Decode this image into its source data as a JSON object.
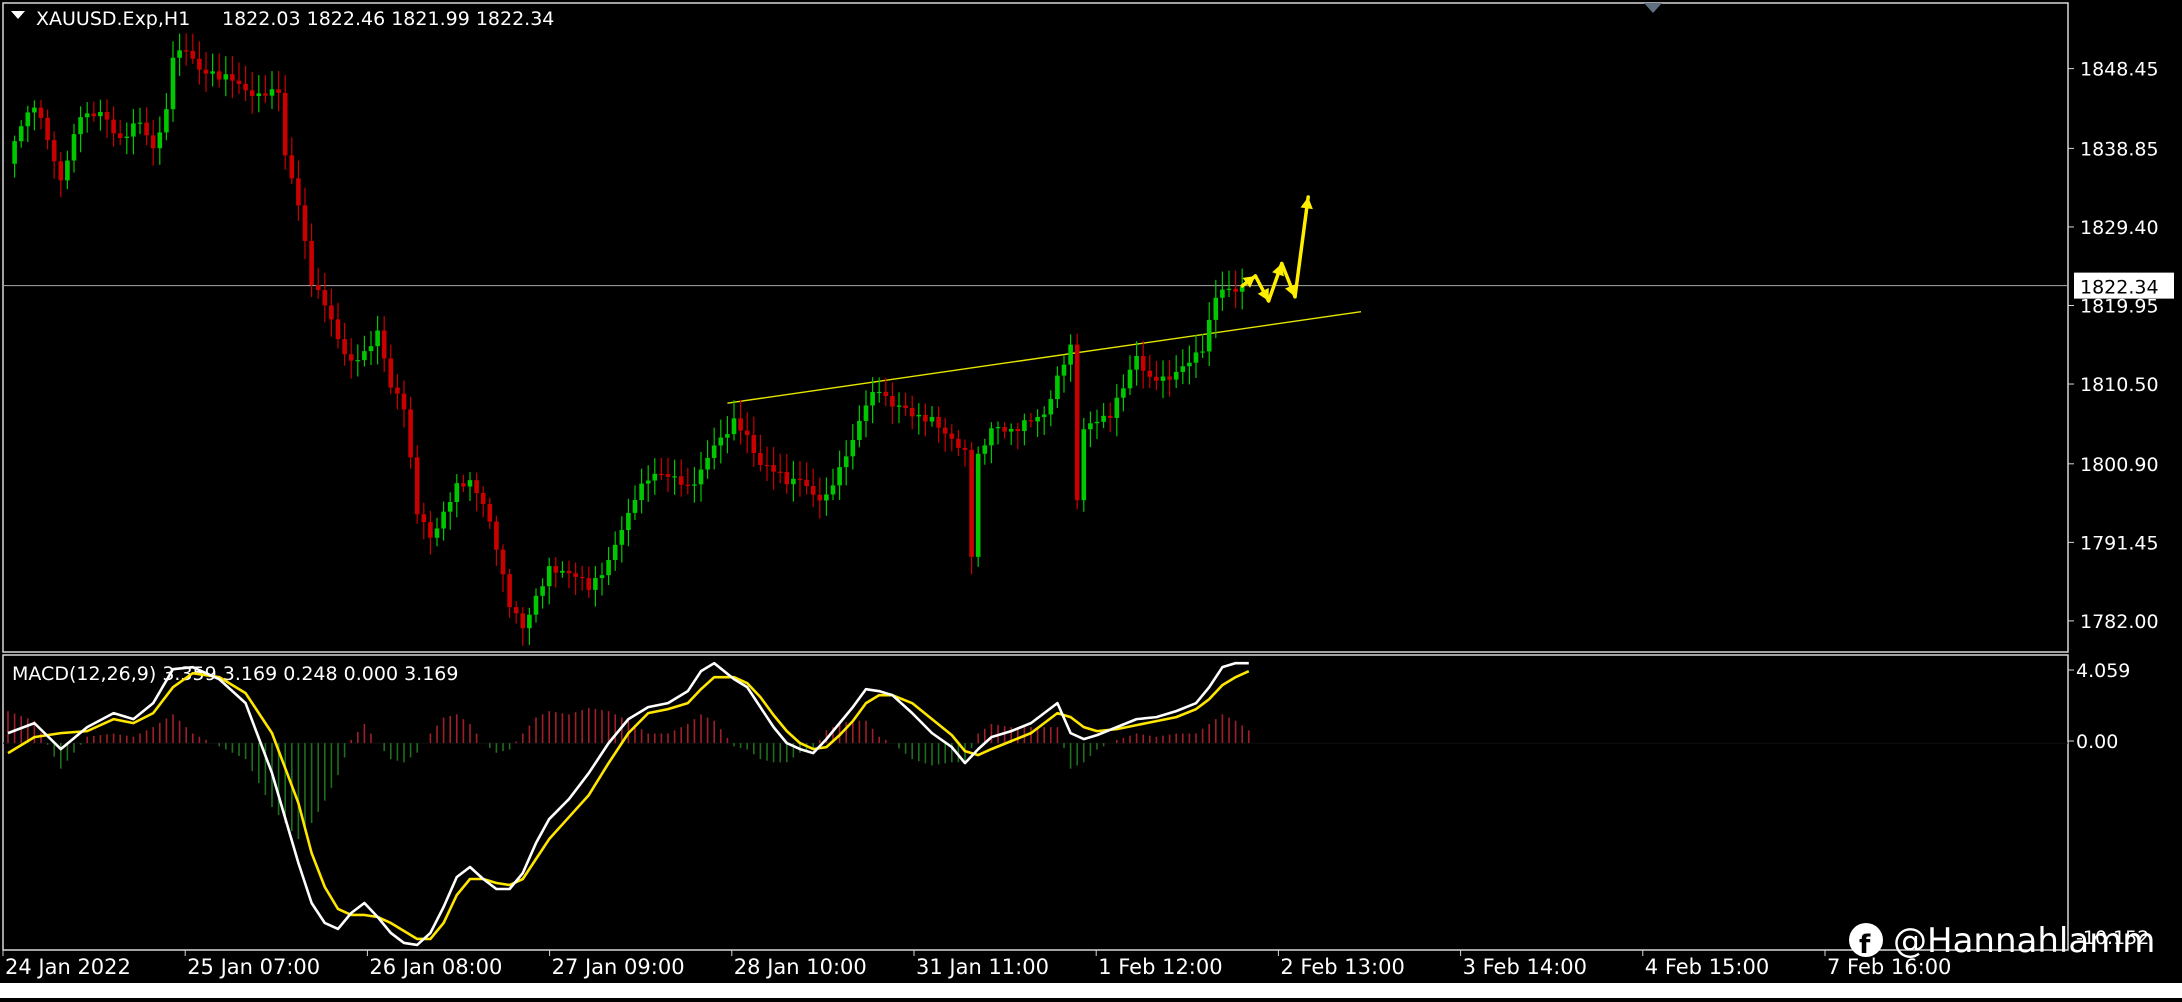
{
  "header": {
    "symbol_label": "XAUUSD.Exp,H1",
    "ohlc_label": "1822.03 1822.46 1821.99 1822.34",
    "dropdown_icon": "triangle-down-icon"
  },
  "macd_header": {
    "label": "MACD(12,26,9) 3.359 3.169 0.248 0.000 3.169"
  },
  "price_axis": {
    "ticks": [
      "1848.45",
      "1838.85",
      "1829.40",
      "1819.95",
      "1810.50",
      "1800.90",
      "1791.45",
      "1782.00"
    ],
    "current_price_label": "1822.34"
  },
  "macd_axis": {
    "ticks": [
      "4.059",
      "0.00"
    ],
    "bottom_tick": "-10.152"
  },
  "time_axis": {
    "labels": [
      "24 Jan 2022",
      "25 Jan 07:00",
      "26 Jan 08:00",
      "27 Jan 09:00",
      "28 Jan 10:00",
      "31 Jan 11:00",
      "1 Feb 12:00",
      "2 Feb 13:00",
      "3 Feb 14:00",
      "4 Feb 15:00",
      "7 Feb 16:00"
    ]
  },
  "watermark": {
    "text": "@Hannahlamm",
    "icon": "facebook-icon"
  },
  "colors": {
    "background": "#000000",
    "bull": "#00c800",
    "bear": "#c80000",
    "macd_line": "#ffffff",
    "signal_line": "#ffe600",
    "trendline": "#e6e600",
    "arrows": "#ffee00",
    "hist_pos": "#a01e2a",
    "hist_neg": "#1e6e1e"
  },
  "chart_data": {
    "type": "candlestick",
    "symbol": "XAUUSD.Exp",
    "timeframe": "H1",
    "last_price": 1822.34,
    "price_range": [
      1778.5,
      1855.5
    ],
    "price_ticks": [
      1848.45,
      1838.85,
      1829.4,
      1819.95,
      1810.5,
      1800.9,
      1791.45,
      1782.0
    ],
    "price_path": [
      [
        0,
        1837
      ],
      [
        2,
        1842
      ],
      [
        4,
        1844
      ],
      [
        6,
        1840
      ],
      [
        8,
        1835
      ],
      [
        10,
        1840
      ],
      [
        11,
        1843
      ],
      [
        14,
        1843
      ],
      [
        17,
        1840
      ],
      [
        20,
        1842
      ],
      [
        22,
        1839
      ],
      [
        24,
        1843
      ],
      [
        25,
        1850
      ],
      [
        27,
        1851
      ],
      [
        29,
        1848
      ],
      [
        31,
        1848
      ],
      [
        34,
        1847
      ],
      [
        38,
        1845
      ],
      [
        41,
        1846
      ],
      [
        42,
        1838
      ],
      [
        44,
        1832
      ],
      [
        46,
        1823
      ],
      [
        48,
        1820
      ],
      [
        50,
        1816
      ],
      [
        52,
        1813
      ],
      [
        54,
        1814
      ],
      [
        56,
        1817
      ],
      [
        58,
        1810
      ],
      [
        60,
        1808
      ],
      [
        62,
        1795
      ],
      [
        64,
        1792
      ],
      [
        66,
        1795
      ],
      [
        68,
        1798
      ],
      [
        70,
        1799
      ],
      [
        72,
        1796
      ],
      [
        74,
        1791
      ],
      [
        76,
        1784
      ],
      [
        78,
        1781
      ],
      [
        80,
        1785
      ],
      [
        82,
        1788
      ],
      [
        85,
        1788
      ],
      [
        88,
        1786
      ],
      [
        91,
        1789
      ],
      [
        93,
        1793
      ],
      [
        95,
        1797
      ],
      [
        97,
        1799
      ],
      [
        99,
        1800
      ],
      [
        101,
        1799
      ],
      [
        103,
        1798
      ],
      [
        105,
        1800
      ],
      [
        107,
        1803
      ],
      [
        110,
        1806
      ],
      [
        112,
        1804
      ],
      [
        114,
        1801
      ],
      [
        116,
        1800
      ],
      [
        118,
        1799
      ],
      [
        120,
        1799
      ],
      [
        122,
        1797
      ],
      [
        124,
        1797
      ],
      [
        126,
        1800
      ],
      [
        128,
        1804
      ],
      [
        130,
        1808
      ],
      [
        132,
        1810
      ],
      [
        134,
        1808
      ],
      [
        137,
        1807
      ],
      [
        140,
        1806
      ],
      [
        143,
        1804
      ],
      [
        145,
        1802
      ],
      [
        146,
        1790
      ],
      [
        147,
        1802
      ],
      [
        149,
        1805
      ],
      [
        152,
        1805
      ],
      [
        155,
        1806
      ],
      [
        157,
        1807
      ],
      [
        159,
        1811
      ],
      [
        161,
        1815
      ],
      [
        162,
        1797
      ],
      [
        163,
        1805
      ],
      [
        165,
        1806
      ],
      [
        167,
        1807
      ],
      [
        169,
        1810
      ],
      [
        171,
        1814
      ],
      [
        173,
        1811
      ],
      [
        175,
        1811
      ],
      [
        177,
        1812
      ],
      [
        179,
        1813
      ],
      [
        181,
        1815
      ],
      [
        183,
        1821
      ],
      [
        185,
        1822
      ],
      [
        187,
        1822
      ]
    ],
    "arrows_projection": [
      [
        187,
        1822.3
      ],
      [
        189,
        1823.5
      ],
      [
        191,
        1820.5
      ],
      [
        193,
        1825
      ],
      [
        195,
        1821
      ],
      [
        197,
        1833
      ]
    ],
    "current_price_line": 1822.34,
    "trendline": [
      [
        109,
        1808.2
      ],
      [
        205,
        1819.2
      ]
    ],
    "macd": {
      "range": [
        -10.152,
        4.059
      ],
      "ticks": [
        4.059,
        0.0
      ],
      "macd_path": [
        [
          0,
          0.5
        ],
        [
          4,
          1.0
        ],
        [
          8,
          -0.3
        ],
        [
          12,
          0.8
        ],
        [
          16,
          1.5
        ],
        [
          19,
          1.2
        ],
        [
          22,
          2.0
        ],
        [
          25,
          3.7
        ],
        [
          28,
          3.8
        ],
        [
          32,
          3.2
        ],
        [
          36,
          2.0
        ],
        [
          40,
          -1.5
        ],
        [
          44,
          -6.0
        ],
        [
          46,
          -8.0
        ],
        [
          48,
          -9.0
        ],
        [
          50,
          -9.3
        ],
        [
          52,
          -8.5
        ],
        [
          54,
          -8.0
        ],
        [
          56,
          -8.7
        ],
        [
          58,
          -9.5
        ],
        [
          60,
          -10.0
        ],
        [
          62,
          -10.1
        ],
        [
          64,
          -9.5
        ],
        [
          66,
          -8.2
        ],
        [
          68,
          -6.7
        ],
        [
          70,
          -6.2
        ],
        [
          72,
          -6.8
        ],
        [
          74,
          -7.3
        ],
        [
          76,
          -7.3
        ],
        [
          78,
          -6.5
        ],
        [
          80,
          -5.0
        ],
        [
          82,
          -3.8
        ],
        [
          85,
          -2.8
        ],
        [
          88,
          -1.5
        ],
        [
          91,
          0.0
        ],
        [
          94,
          1.2
        ],
        [
          97,
          1.8
        ],
        [
          100,
          2.0
        ],
        [
          103,
          2.6
        ],
        [
          105,
          3.6
        ],
        [
          107,
          4.0
        ],
        [
          110,
          3.2
        ],
        [
          112,
          2.8
        ],
        [
          114,
          1.8
        ],
        [
          116,
          0.8
        ],
        [
          118,
          0.0
        ],
        [
          120,
          -0.3
        ],
        [
          122,
          -0.5
        ],
        [
          124,
          0.2
        ],
        [
          126,
          1.0
        ],
        [
          128,
          1.8
        ],
        [
          130,
          2.7
        ],
        [
          132,
          2.6
        ],
        [
          134,
          2.4
        ],
        [
          137,
          1.5
        ],
        [
          140,
          0.5
        ],
        [
          143,
          -0.2
        ],
        [
          145,
          -1.0
        ],
        [
          147,
          -0.3
        ],
        [
          149,
          0.3
        ],
        [
          152,
          0.6
        ],
        [
          155,
          1.0
        ],
        [
          157,
          1.5
        ],
        [
          159,
          2.0
        ],
        [
          161,
          0.5
        ],
        [
          163,
          0.2
        ],
        [
          165,
          0.4
        ],
        [
          168,
          0.8
        ],
        [
          171,
          1.2
        ],
        [
          174,
          1.3
        ],
        [
          177,
          1.6
        ],
        [
          180,
          2.0
        ],
        [
          182,
          2.8
        ],
        [
          184,
          3.8
        ],
        [
          186,
          4.0
        ],
        [
          188,
          4.0
        ]
      ],
      "signal_path": [
        [
          0,
          -0.5
        ],
        [
          4,
          0.3
        ],
        [
          8,
          0.5
        ],
        [
          12,
          0.6
        ],
        [
          16,
          1.2
        ],
        [
          19,
          1.0
        ],
        [
          22,
          1.5
        ],
        [
          25,
          2.8
        ],
        [
          28,
          3.5
        ],
        [
          32,
          3.3
        ],
        [
          36,
          2.5
        ],
        [
          40,
          0.5
        ],
        [
          44,
          -3.0
        ],
        [
          46,
          -5.5
        ],
        [
          48,
          -7.2
        ],
        [
          50,
          -8.3
        ],
        [
          52,
          -8.6
        ],
        [
          54,
          -8.6
        ],
        [
          56,
          -8.7
        ],
        [
          58,
          -9.0
        ],
        [
          60,
          -9.4
        ],
        [
          62,
          -9.8
        ],
        [
          64,
          -9.8
        ],
        [
          66,
          -9.0
        ],
        [
          68,
          -7.6
        ],
        [
          70,
          -6.8
        ],
        [
          72,
          -6.8
        ],
        [
          74,
          -7.0
        ],
        [
          76,
          -7.1
        ],
        [
          78,
          -6.8
        ],
        [
          80,
          -5.8
        ],
        [
          82,
          -4.8
        ],
        [
          85,
          -3.7
        ],
        [
          88,
          -2.6
        ],
        [
          91,
          -1.0
        ],
        [
          94,
          0.5
        ],
        [
          97,
          1.5
        ],
        [
          100,
          1.7
        ],
        [
          103,
          2.0
        ],
        [
          105,
          2.7
        ],
        [
          107,
          3.3
        ],
        [
          110,
          3.3
        ],
        [
          112,
          3.0
        ],
        [
          114,
          2.3
        ],
        [
          116,
          1.4
        ],
        [
          118,
          0.6
        ],
        [
          120,
          0.0
        ],
        [
          122,
          -0.3
        ],
        [
          124,
          -0.2
        ],
        [
          126,
          0.4
        ],
        [
          128,
          1.1
        ],
        [
          130,
          2.0
        ],
        [
          132,
          2.4
        ],
        [
          134,
          2.4
        ],
        [
          137,
          2.0
        ],
        [
          140,
          1.2
        ],
        [
          143,
          0.4
        ],
        [
          145,
          -0.4
        ],
        [
          147,
          -0.6
        ],
        [
          149,
          -0.3
        ],
        [
          152,
          0.1
        ],
        [
          155,
          0.5
        ],
        [
          157,
          1.0
        ],
        [
          159,
          1.5
        ],
        [
          161,
          1.3
        ],
        [
          163,
          0.8
        ],
        [
          165,
          0.6
        ],
        [
          168,
          0.7
        ],
        [
          171,
          0.9
        ],
        [
          174,
          1.1
        ],
        [
          177,
          1.3
        ],
        [
          180,
          1.7
        ],
        [
          182,
          2.2
        ],
        [
          184,
          2.9
        ],
        [
          186,
          3.3
        ],
        [
          188,
          3.6
        ]
      ]
    },
    "time_labels_at_bar": [
      0,
      24,
      46,
      68,
      90,
      112,
      134,
      156,
      178,
      200,
      222
    ]
  }
}
